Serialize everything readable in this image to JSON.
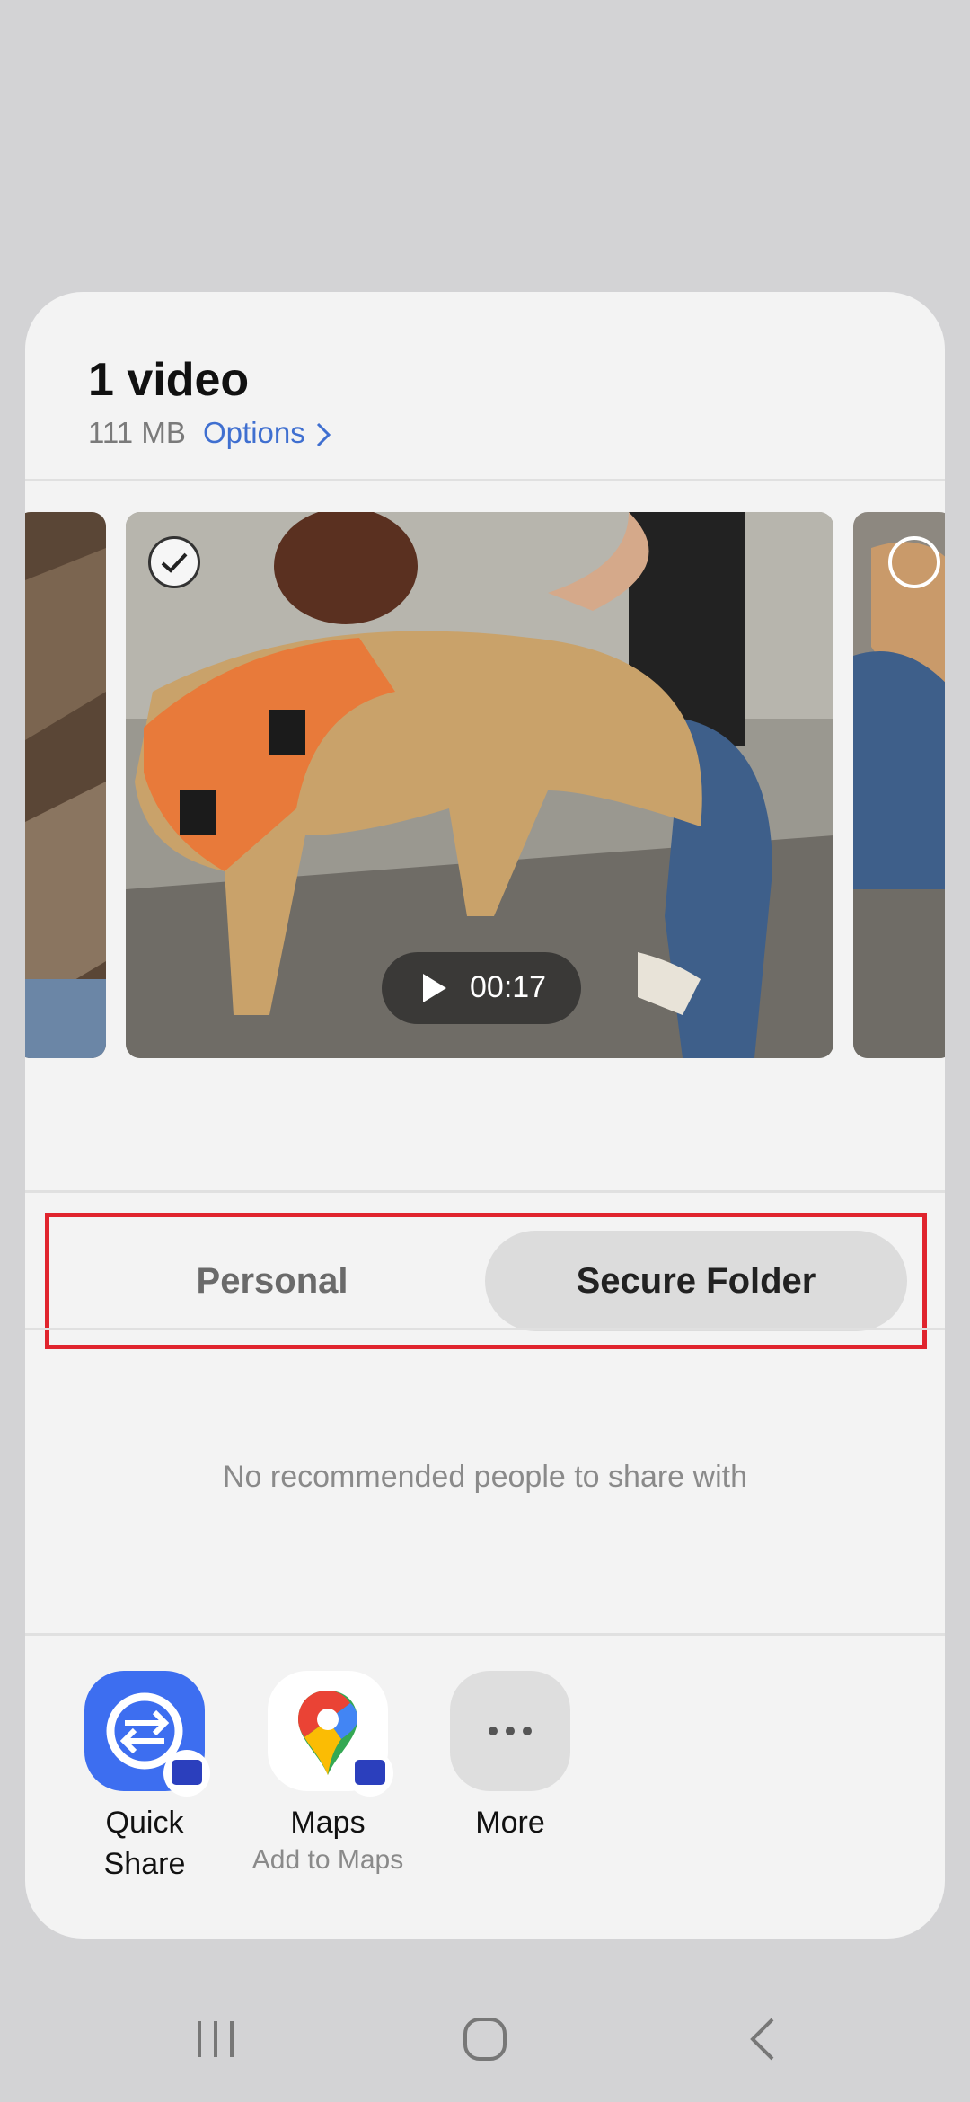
{
  "header": {
    "title": "1 video",
    "size": "111 MB",
    "options_label": "Options"
  },
  "preview": {
    "duration": "00:17",
    "selected": true
  },
  "profile_switch": {
    "personal_label": "Personal",
    "secure_label": "Secure Folder",
    "active": "Secure Folder"
  },
  "recommendations": {
    "empty_text": "No recommended people to share with"
  },
  "apps": [
    {
      "label_line1": "Quick",
      "label_line2": "Share",
      "sub": ""
    },
    {
      "label_line1": "Maps",
      "label_line2": "",
      "sub": "Add to Maps"
    },
    {
      "label_line1": "More",
      "label_line2": "",
      "sub": ""
    }
  ],
  "colors": {
    "accent": "#3f6fd0",
    "highlight": "#e0242d",
    "quick_share": "#3d6ef0"
  },
  "icons": {
    "nav_recent": "recent-apps-icon",
    "nav_home": "home-icon",
    "nav_back": "back-icon"
  }
}
